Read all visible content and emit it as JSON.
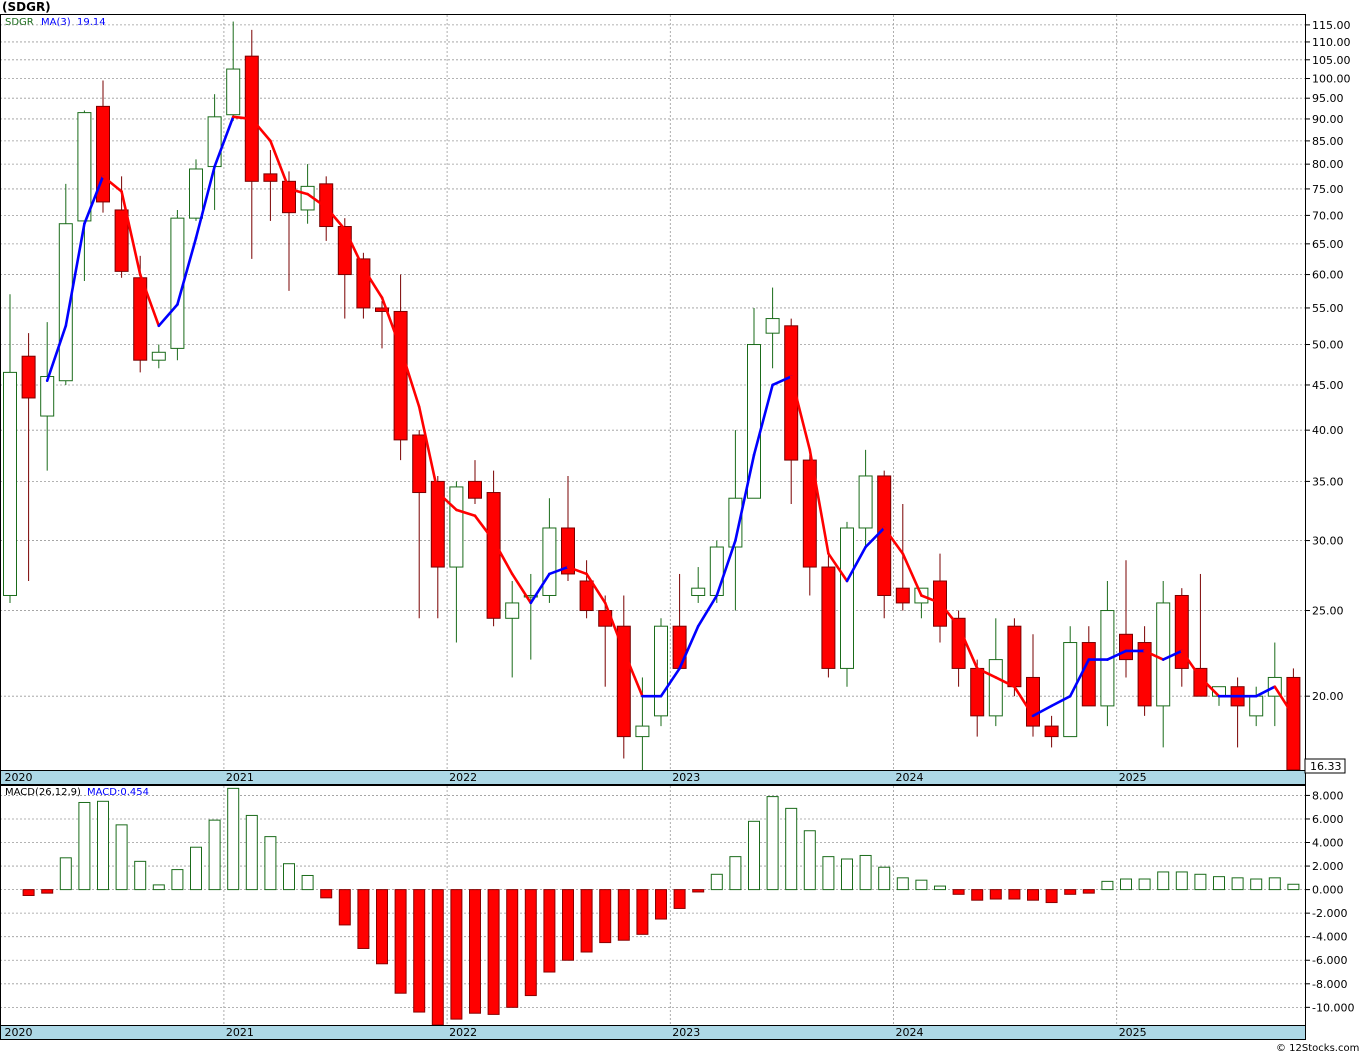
{
  "header": {
    "ticker_label": "(SDGR)",
    "price_legend": "SDGR",
    "ma_legend": "MA(3)",
    "ma_value": "19.14",
    "macd_legend": "MACD(26,12,9)",
    "macd_value_legend": "MACD:0.454",
    "last_price": "16.33",
    "credit": "© 12Stocks.com"
  },
  "colors": {
    "up_fill": "#ffffff",
    "up_stroke": "#1a6b1a",
    "down_fill": "#ff0000",
    "down_stroke": "#7a0000",
    "ma_up": "#0000ff",
    "ma_down": "#ff0000",
    "macd_pos_stroke": "#1a6b1a",
    "macd_neg_fill": "#ff0000",
    "band": "#add8e6"
  },
  "chart_data": [
    {
      "type": "candlestick",
      "scale": "log",
      "ylim": [
        16.5,
        118
      ],
      "yticks": [
        20,
        25,
        30,
        35,
        40,
        45,
        50,
        55,
        60,
        65,
        70,
        75,
        80,
        85,
        90,
        95,
        100,
        105,
        110,
        115
      ],
      "ytick_labels": [
        "20.00",
        "25.00",
        "30.00",
        "35.00",
        "40.00",
        "45.00",
        "50.00",
        "55.00",
        "60.00",
        "65.00",
        "70.00",
        "75.00",
        "80.00",
        "85.00",
        "90.00",
        "95.00",
        "100.00",
        "105.00",
        "110.00",
        "115.00"
      ],
      "year_labels": [
        {
          "label": "2020",
          "index": -0.4
        },
        {
          "label": "2021",
          "index": 11.5
        },
        {
          "label": "2022",
          "index": 23.5
        },
        {
          "label": "2023",
          "index": 35.5
        },
        {
          "label": "2024",
          "index": 47.5
        },
        {
          "label": "2025",
          "index": 59.5
        }
      ],
      "ohlc": [
        [
          26.0,
          57.0,
          25.5,
          46.5
        ],
        [
          48.5,
          51.5,
          27.0,
          43.5
        ],
        [
          41.5,
          53.0,
          36.0,
          46.0
        ],
        [
          45.5,
          76.0,
          45.0,
          68.5
        ],
        [
          69.0,
          92.0,
          59.0,
          91.5
        ],
        [
          93.0,
          99.5,
          70.5,
          72.5
        ],
        [
          71.0,
          77.5,
          59.5,
          60.5
        ],
        [
          59.5,
          63.0,
          46.5,
          48.0
        ],
        [
          48.0,
          50.0,
          47.0,
          49.0
        ],
        [
          49.5,
          71.0,
          48.0,
          69.5
        ],
        [
          69.5,
          81.0,
          69.0,
          79.0
        ],
        [
          79.5,
          96.0,
          71.0,
          90.5
        ],
        [
          91.0,
          116.0,
          89.5,
          102.5
        ],
        [
          106.0,
          113.5,
          62.5,
          76.5
        ],
        [
          78.0,
          83.0,
          69.0,
          76.5
        ],
        [
          76.5,
          78.5,
          57.5,
          70.5
        ],
        [
          71.0,
          80.0,
          68.5,
          75.5
        ],
        [
          76.0,
          77.5,
          65.5,
          68.0
        ],
        [
          68.0,
          69.5,
          53.5,
          60.0
        ],
        [
          62.5,
          63.5,
          53.5,
          55.0
        ],
        [
          55.0,
          56.0,
          49.5,
          54.5
        ],
        [
          54.5,
          60.0,
          37.0,
          39.0
        ],
        [
          39.5,
          40.0,
          24.5,
          34.0
        ],
        [
          35.0,
          35.5,
          24.5,
          28.0
        ],
        [
          28.0,
          35.0,
          23.0,
          34.5
        ],
        [
          35.0,
          37.0,
          33.0,
          33.5
        ],
        [
          34.0,
          36.0,
          24.0,
          24.5
        ],
        [
          24.5,
          27.0,
          21.0,
          25.5
        ],
        [
          26.0,
          27.5,
          22.0,
          26.0
        ],
        [
          26.0,
          33.5,
          25.5,
          31.0
        ],
        [
          31.0,
          35.5,
          27.0,
          27.5
        ],
        [
          27.0,
          28.5,
          24.5,
          25.0
        ],
        [
          25.0,
          26.0,
          20.5,
          24.0
        ],
        [
          24.0,
          26.0,
          17.0,
          18.0
        ],
        [
          18.0,
          21.0,
          16.5,
          18.5
        ],
        [
          19.0,
          24.5,
          18.5,
          24.0
        ],
        [
          24.0,
          27.5,
          21.5,
          21.5
        ],
        [
          26.0,
          28.0,
          25.5,
          26.5
        ],
        [
          26.0,
          30.0,
          25.5,
          29.5
        ],
        [
          29.5,
          40.0,
          25.0,
          33.5
        ],
        [
          33.5,
          55.0,
          33.5,
          50.0
        ],
        [
          51.5,
          58.0,
          47.0,
          53.5
        ],
        [
          52.5,
          53.5,
          33.0,
          37.0
        ],
        [
          37.0,
          37.5,
          26.0,
          28.0
        ],
        [
          28.0,
          29.0,
          21.0,
          21.5
        ],
        [
          21.5,
          31.5,
          20.5,
          31.0
        ],
        [
          31.0,
          38.0,
          29.5,
          35.5
        ],
        [
          35.5,
          36.0,
          24.5,
          26.0
        ],
        [
          26.5,
          33.0,
          25.0,
          25.5
        ],
        [
          25.5,
          26.5,
          24.5,
          26.5
        ],
        [
          27.0,
          29.0,
          23.0,
          24.0
        ],
        [
          24.5,
          25.0,
          20.5,
          21.5
        ],
        [
          21.5,
          22.0,
          18.0,
          19.0
        ],
        [
          19.0,
          24.5,
          18.5,
          22.0
        ],
        [
          24.0,
          24.5,
          20.0,
          20.5
        ],
        [
          21.0,
          23.5,
          18.0,
          18.5
        ],
        [
          18.5,
          19.0,
          17.5,
          18.0
        ],
        [
          18.0,
          24.0,
          18.0,
          23.0
        ],
        [
          23.0,
          24.0,
          19.5,
          19.5
        ],
        [
          19.5,
          27.0,
          18.5,
          25.0
        ],
        [
          23.5,
          28.5,
          21.0,
          22.0
        ],
        [
          23.0,
          24.0,
          19.0,
          19.5
        ],
        [
          19.5,
          27.0,
          17.5,
          25.5
        ],
        [
          26.0,
          26.5,
          20.5,
          21.5
        ],
        [
          21.5,
          27.5,
          20.0,
          20.0
        ],
        [
          20.0,
          20.5,
          19.5,
          20.5
        ],
        [
          20.5,
          21.0,
          17.5,
          19.5
        ],
        [
          19.0,
          20.5,
          18.5,
          20.0
        ],
        [
          20.0,
          23.0,
          18.5,
          21.0
        ],
        [
          21.0,
          21.5,
          16.5,
          16.5
        ]
      ],
      "ma3": [
        null,
        null,
        45.5,
        52.5,
        68.5,
        77.5,
        74.5,
        60.0,
        52.5,
        55.5,
        66.0,
        79.5,
        90.5,
        90.0,
        85.0,
        75.0,
        74.0,
        71.5,
        67.5,
        61.0,
        56.5,
        49.5,
        42.5,
        34.0,
        32.5,
        32.0,
        30.0,
        27.5,
        25.5,
        27.5,
        28.0,
        27.5,
        25.5,
        22.5,
        20.0,
        20.0,
        21.5,
        24.0,
        26.0,
        30.0,
        37.5,
        45.0,
        46.0,
        38.0,
        29.0,
        27.0,
        29.5,
        31.0,
        29.0,
        26.0,
        25.5,
        24.0,
        21.5,
        21.0,
        20.5,
        19.0,
        19.5,
        20.0,
        22.0,
        22.0,
        22.5,
        22.5,
        22.0,
        22.5,
        21.0,
        20.0,
        20.0,
        20.0,
        20.5,
        19.0
      ]
    },
    {
      "type": "bar",
      "name": "MACD(26,12,9)",
      "ylim": [
        -11.5,
        8.8
      ],
      "yticks": [
        -10,
        -8,
        -6,
        -4,
        -2,
        0,
        2,
        4,
        6,
        8
      ],
      "ytick_labels": [
        "-10.000",
        "-8.000",
        "-6.000",
        "-4.000",
        "-2.000",
        "0.000",
        "2.000",
        "4.000",
        "6.000",
        "8.000"
      ],
      "year_labels": [
        {
          "label": "2020",
          "index": -0.4
        },
        {
          "label": "2021",
          "index": 11.5
        },
        {
          "label": "2022",
          "index": 23.5
        },
        {
          "label": "2023",
          "index": 35.5
        },
        {
          "label": "2024",
          "index": 47.5
        },
        {
          "label": "2025",
          "index": 59.5
        }
      ],
      "values": [
        null,
        -0.5,
        -0.3,
        2.7,
        7.4,
        7.5,
        5.5,
        2.4,
        0.4,
        1.7,
        3.6,
        5.9,
        8.6,
        6.3,
        4.5,
        2.2,
        1.2,
        -0.7,
        -3.0,
        -5.0,
        -6.3,
        -8.8,
        -10.4,
        -11.5,
        -11.0,
        -10.5,
        -10.6,
        -10.0,
        -9.0,
        -7.0,
        -6.0,
        -5.3,
        -4.5,
        -4.3,
        -3.8,
        -2.5,
        -1.6,
        -0.2,
        1.3,
        2.8,
        5.8,
        7.9,
        6.9,
        5.0,
        2.8,
        2.6,
        2.9,
        1.9,
        1.0,
        0.8,
        0.3,
        -0.4,
        -0.9,
        -0.8,
        -0.8,
        -0.9,
        -1.1,
        -0.4,
        -0.3,
        0.7,
        0.9,
        0.9,
        1.5,
        1.5,
        1.3,
        1.1,
        1.0,
        0.9,
        1.0,
        0.454
      ]
    }
  ]
}
